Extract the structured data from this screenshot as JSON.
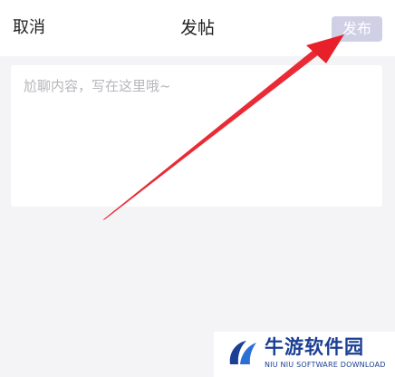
{
  "header": {
    "cancel_label": "取消",
    "title": "发帖",
    "publish_label": "发布"
  },
  "editor": {
    "placeholder": "尬聊内容，写在这里哦~",
    "value": ""
  },
  "watermark": {
    "title": "牛游软件园",
    "subtitle": "NIU NIU SOFTWARE DOWNLOAD"
  },
  "colors": {
    "background": "#f4f4f6",
    "surface": "#ffffff",
    "publish_disabled": "#cfd0e6",
    "annotation_arrow": "#e8202a",
    "watermark_blue": "#1a3f93"
  },
  "icons": {
    "annotation": "red-arrow-icon",
    "watermark_logo": "niuyou-logo-icon"
  }
}
